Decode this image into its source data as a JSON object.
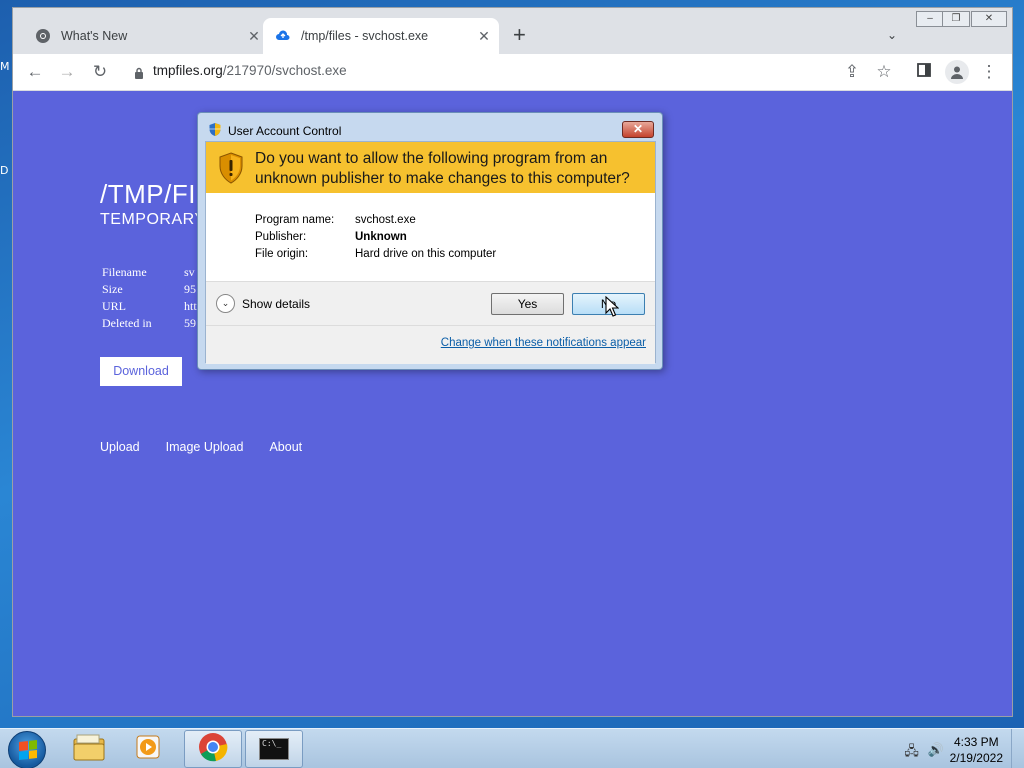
{
  "desktop": {
    "frag_top": "M",
    "frag_mid": "D"
  },
  "browser": {
    "tabs": [
      {
        "title": "What's New",
        "icon": "chrome-icon",
        "active": false
      },
      {
        "title": "/tmp/files - svchost.exe",
        "icon": "cloud-upload-icon",
        "active": true
      }
    ],
    "close_glyph": "✕",
    "new_tab_glyph": "+",
    "tab_menu_glyph": "⌄",
    "window_controls": {
      "minimize": "–",
      "maximize": "❐",
      "close": "✕"
    },
    "toolbar": {
      "back_glyph": "←",
      "forward_glyph": "→",
      "reload_glyph": "↻",
      "url_host": "tmpfiles.org",
      "url_path": "/217970/svchost.exe",
      "share_glyph": "⇪",
      "star_glyph": "☆",
      "menu_glyph": "⋮"
    }
  },
  "page": {
    "title": "/TMP/FI",
    "subtitle": "TEMPORARY",
    "info": [
      {
        "key": "Filename",
        "value": "sv"
      },
      {
        "key": "Size",
        "value": "95"
      },
      {
        "key": "URL",
        "value": "htt"
      },
      {
        "key": "Deleted in",
        "value": "59"
      }
    ],
    "download_label": "Download",
    "links": [
      "Upload",
      "Image Upload",
      "About"
    ]
  },
  "uac": {
    "title": "User Account Control",
    "close_glyph": "✕",
    "question_line1": "Do you want to allow the following program from an",
    "question_line2": "unknown publisher to make changes to this computer?",
    "details": [
      {
        "key": "Program name:",
        "value": "svchost.exe",
        "bold": false
      },
      {
        "key": "Publisher:",
        "value": "Unknown",
        "bold": true
      },
      {
        "key": "File origin:",
        "value": "Hard drive on this computer",
        "bold": false
      }
    ],
    "show_details_label": "Show details",
    "chevron_glyph": "⌄",
    "yes_label": "Yes",
    "no_label": "No",
    "change_link": "Change when these notifications appear"
  },
  "taskbar": {
    "apps": [
      "file-explorer-icon",
      "media-player-icon",
      "chrome-icon",
      "command-prompt-icon"
    ],
    "cmd_text": "C:\\_",
    "tray_network": "🖧",
    "tray_volume": "🔊",
    "time": "4:33 PM",
    "date": "2/19/2022"
  },
  "colors": {
    "page_bg": "#5b63dc",
    "uac_banner": "#f6c12f",
    "link": "#0b5ea8"
  }
}
